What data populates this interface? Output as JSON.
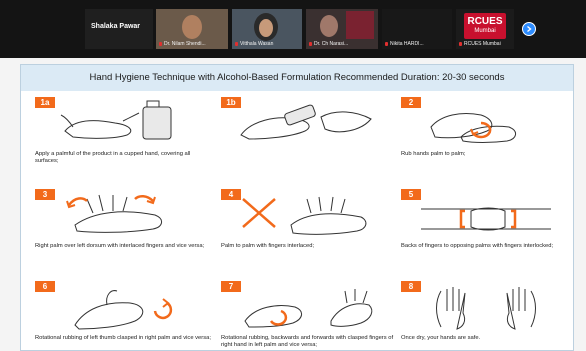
{
  "meeting": {
    "host_name": "Shalaka Pawar",
    "participants": [
      {
        "name": "Dr. Nilam Shendi..."
      },
      {
        "name": "Vitthala Wasan"
      },
      {
        "name": "Dr. Ch Narasi..."
      },
      {
        "name": "Nikita HARDI..."
      },
      {
        "name": "RCUES Mumbai"
      }
    ],
    "logo": {
      "line1": "RCUES",
      "line2": "Mumbai"
    }
  },
  "poster": {
    "title": "Hand Hygiene Technique with Alcohol-Based Formulation Recommended Duration: 20-30 seconds",
    "steps": [
      {
        "badge": "1a",
        "caption": "Apply a palmful of the product in a cupped hand, covering all surfaces;"
      },
      {
        "badge": "1b",
        "caption": ""
      },
      {
        "badge": "2",
        "caption": "Rub hands palm to palm;"
      },
      {
        "badge": "3",
        "caption": "Right palm over left dorsum with interlaced fingers and vice versa;"
      },
      {
        "badge": "4",
        "caption": "Palm to palm with fingers interlaced;"
      },
      {
        "badge": "5",
        "caption": "Backs of fingers to opposing palms with fingers interlocked;"
      },
      {
        "badge": "6",
        "caption": "Rotational rubbing of left thumb clasped in right palm and vice versa;"
      },
      {
        "badge": "7",
        "caption": "Rotational rubbing, backwards and forwards with clasped fingers of right hand in left palm and vice versa;"
      },
      {
        "badge": "8",
        "caption": "Once dry, your hands are safe."
      }
    ]
  },
  "colors": {
    "badge": "#f26a1b",
    "title_band": "#dbeaf5",
    "next_button": "#2d8cff",
    "logo": "#c8102e"
  },
  "icons": [
    "mic-muted-icon",
    "next-arrow-icon"
  ]
}
